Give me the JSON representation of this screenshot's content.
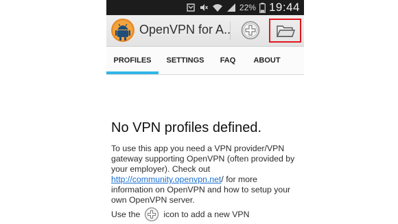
{
  "status_bar": {
    "battery_percent": "22%",
    "time": "19:44",
    "icons": [
      "notification-icon",
      "mute-icon",
      "wifi-icon",
      "signal-icon",
      "battery-icon"
    ]
  },
  "action_bar": {
    "app_icon": "openvpn-android-icon",
    "title": "OpenVPN for A..",
    "add_icon": "add-circle-icon",
    "import_icon": "folder-icon",
    "import_highlight_color": "#e0161e"
  },
  "tabs": [
    {
      "label": "PROFILES",
      "selected": true
    },
    {
      "label": "SETTINGS",
      "selected": false
    },
    {
      "label": "FAQ",
      "selected": false
    },
    {
      "label": "ABOUT",
      "selected": false
    }
  ],
  "tab_accent_color": "#33b5e5",
  "content": {
    "empty_title": "No VPN profiles defined.",
    "desc_before_link": "To use this app you need a VPN provider/VPN gateway supporting OpenVPN (often provided by your employer). Check out ",
    "link_text": "http://community.openvpn.net",
    "desc_after_link": "/ for more information on OpenVPN and how to setup your own OpenVPN server.",
    "use_before": "Use the",
    "use_after": "icon to add a new VPN"
  }
}
